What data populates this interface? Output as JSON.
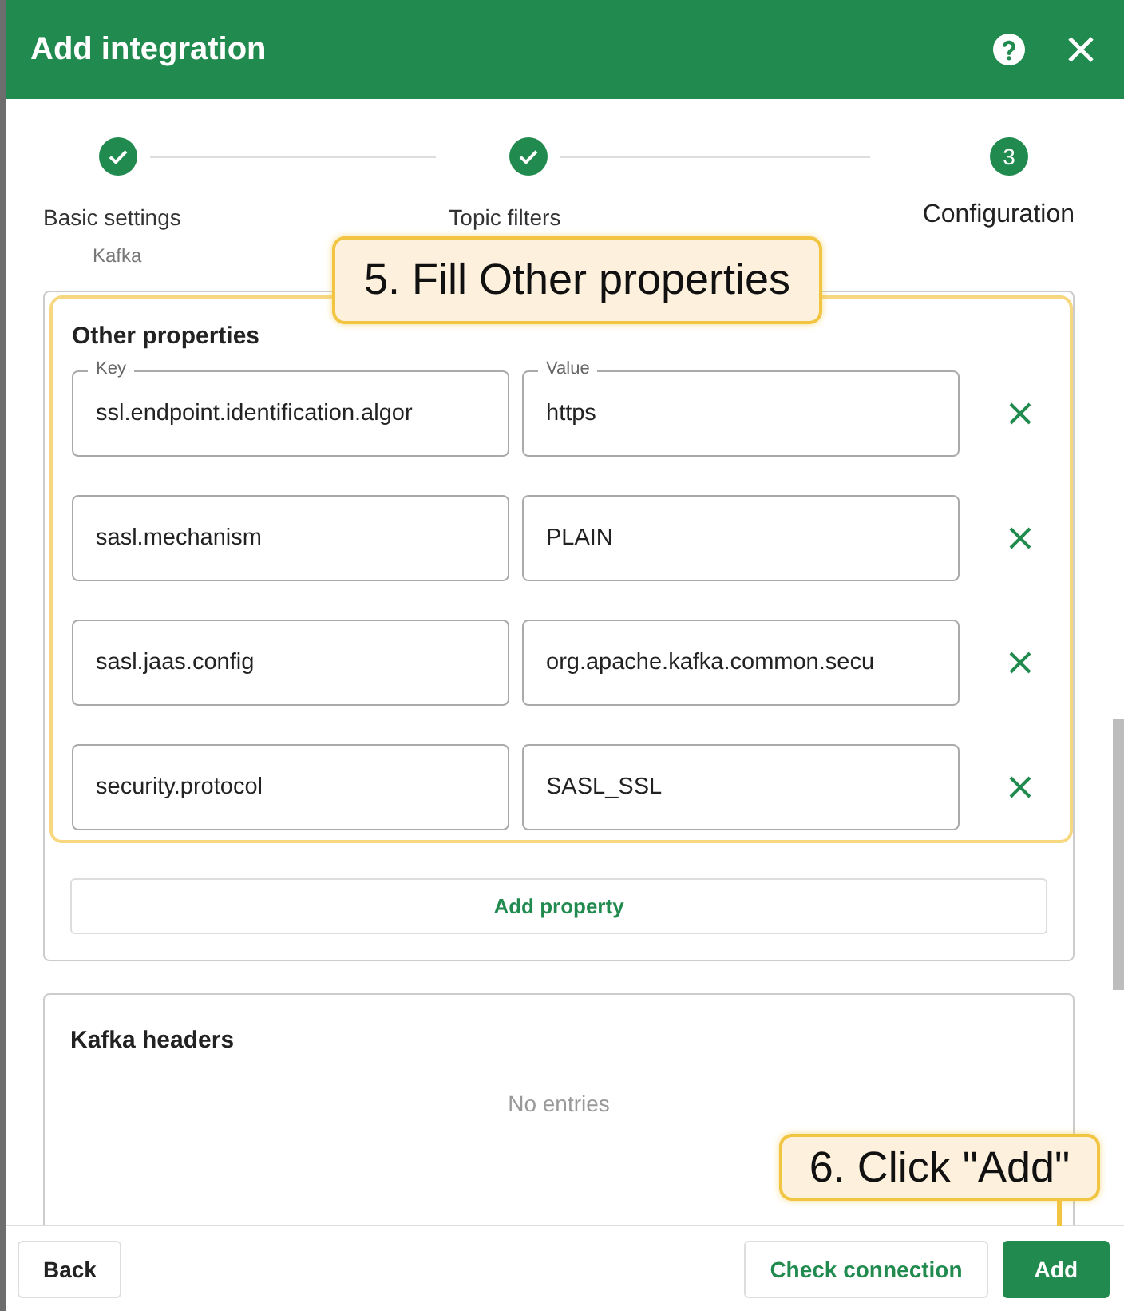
{
  "window": {
    "title": "Add integration"
  },
  "steps": [
    {
      "label": "Basic settings",
      "sublabel": "Kafka",
      "done": true,
      "active": false
    },
    {
      "label": "Topic filters",
      "done": true,
      "active": false
    },
    {
      "label": "Configuration",
      "number": "3",
      "done": false,
      "active": true
    }
  ],
  "sections": [
    {
      "title": "Other properties",
      "highlighted": true,
      "columns": [
        "Key",
        "Value"
      ],
      "rows": [
        {
          "key": "ssl.endpoint.identification.algor",
          "value": "https"
        },
        {
          "key": "sasl.mechanism",
          "value": "PLAIN"
        },
        {
          "key": "sasl.jaas.config",
          "value": "org.apache.kafka.common.secu"
        },
        {
          "key": "security.protocol",
          "value": "SASL_SSL"
        }
      ],
      "add_button": "Add property"
    },
    {
      "title": "Kafka headers",
      "empty_text": "No entries"
    }
  ],
  "callouts": [
    {
      "text": "5. Fill Other properties"
    },
    {
      "text": "6. Click \"Add\"",
      "pointer": true
    }
  ],
  "footer": {
    "buttons": [
      {
        "label": "Back",
        "kind": "plain"
      },
      {
        "label": "Check connection",
        "kind": "outlined"
      },
      {
        "label": "Add",
        "kind": "primary"
      }
    ]
  }
}
